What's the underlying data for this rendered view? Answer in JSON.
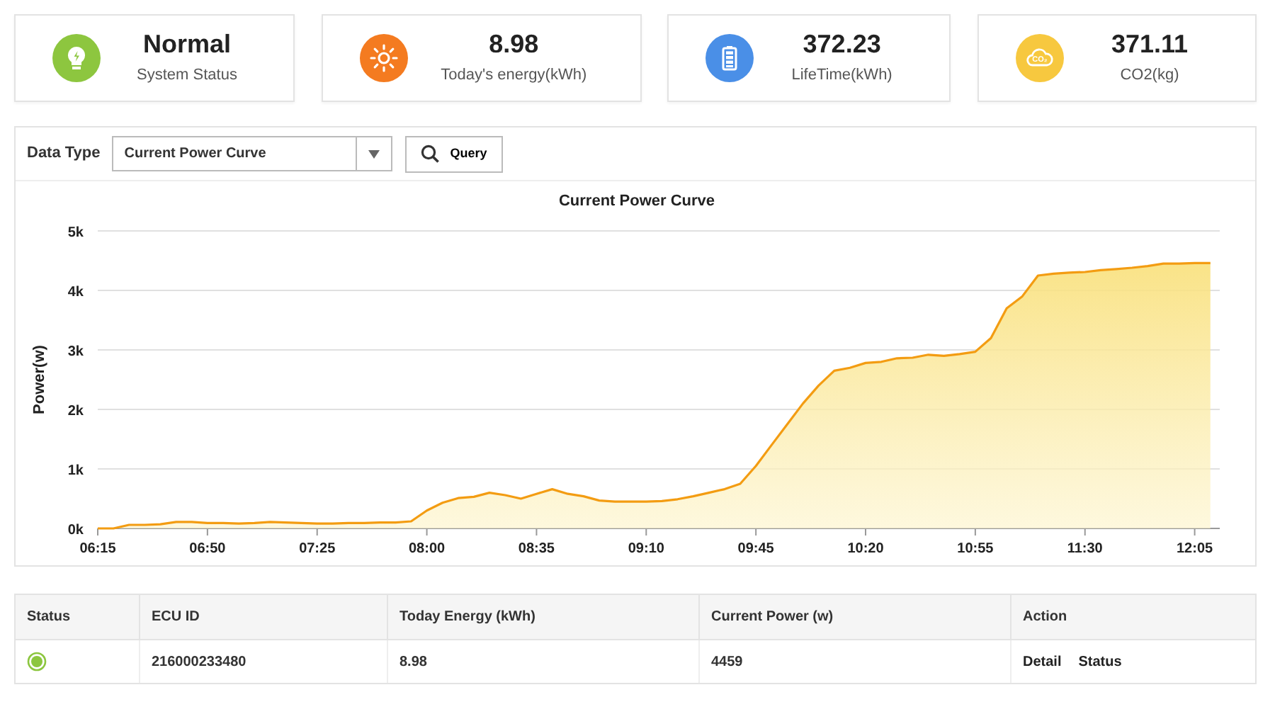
{
  "stats": [
    {
      "kind": "status",
      "value": "Normal",
      "label": "System Status"
    },
    {
      "kind": "energy",
      "value": "8.98",
      "label": "Today's energy(kWh)"
    },
    {
      "kind": "lifetime",
      "value": "372.23",
      "label": "LifeTime(kWh)"
    },
    {
      "kind": "co2",
      "value": "371.11",
      "label": "CO2(kg)",
      "icon_text": "CO₂"
    }
  ],
  "query": {
    "label": "Data Type",
    "value": "Current Power Curve",
    "button": "Query"
  },
  "chart_data": {
    "type": "area",
    "title": "Current Power Curve",
    "ylabel": "Power(w)",
    "grid": true,
    "x": [
      375,
      380,
      385,
      390,
      395,
      400,
      405,
      410,
      415,
      420,
      425,
      430,
      435,
      440,
      445,
      450,
      455,
      460,
      465,
      470,
      475,
      480,
      485,
      490,
      495,
      500,
      505,
      510,
      515,
      520,
      525,
      530,
      535,
      540,
      545,
      550,
      555,
      560,
      565,
      570,
      575,
      580,
      585,
      590,
      595,
      600,
      605,
      610,
      615,
      620,
      625,
      630,
      635,
      640,
      645,
      650,
      655,
      660,
      665,
      670,
      675,
      680,
      685,
      690,
      695,
      700,
      705,
      710,
      715,
      720,
      725,
      730
    ],
    "series": [
      {
        "color": "#f39c12",
        "values": [
          0,
          0,
          60,
          60,
          70,
          110,
          110,
          90,
          90,
          80,
          90,
          110,
          100,
          90,
          80,
          80,
          90,
          90,
          100,
          100,
          120,
          300,
          430,
          510,
          530,
          600,
          560,
          500,
          580,
          660,
          580,
          540,
          470,
          450,
          450,
          450,
          460,
          490,
          540,
          600,
          660,
          750,
          1050,
          1400,
          1750,
          2100,
          2400,
          2650,
          2700,
          2780,
          2800,
          2860,
          2870,
          2920,
          2900,
          2930,
          2970,
          3200,
          3700,
          3900,
          4250,
          4280,
          4300,
          4310,
          4340,
          4360,
          4380,
          4410,
          4450,
          4450,
          4460,
          4460
        ]
      }
    ],
    "xlim": [
      375,
      733
    ],
    "xticks": [
      {
        "value": 375,
        "label": "06:15"
      },
      {
        "value": 410,
        "label": "06:50"
      },
      {
        "value": 445,
        "label": "07:25"
      },
      {
        "value": 480,
        "label": "08:00"
      },
      {
        "value": 515,
        "label": "08:35"
      },
      {
        "value": 550,
        "label": "09:10"
      },
      {
        "value": 585,
        "label": "09:45"
      },
      {
        "value": 620,
        "label": "10:20"
      },
      {
        "value": 655,
        "label": "10:55"
      },
      {
        "value": 690,
        "label": "11:30"
      },
      {
        "value": 725,
        "label": "12:05"
      }
    ],
    "ylim": [
      0,
      5000
    ],
    "yticks": [
      {
        "value": 0,
        "label": "0k"
      },
      {
        "value": 1000,
        "label": "1k"
      },
      {
        "value": 2000,
        "label": "2k"
      },
      {
        "value": 3000,
        "label": "3k"
      },
      {
        "value": 4000,
        "label": "4k"
      },
      {
        "value": 5000,
        "label": "5k"
      }
    ]
  },
  "table": {
    "columns": [
      "Status",
      "ECU ID",
      "Today Energy (kWh)",
      "Current Power (w)",
      "Action"
    ],
    "rows": [
      {
        "color": "#8cc63f",
        "ecu_id": "216000233480",
        "today_energy": "8.98",
        "current_power": "4459",
        "actions": [
          "Detail",
          "Status"
        ]
      }
    ]
  }
}
